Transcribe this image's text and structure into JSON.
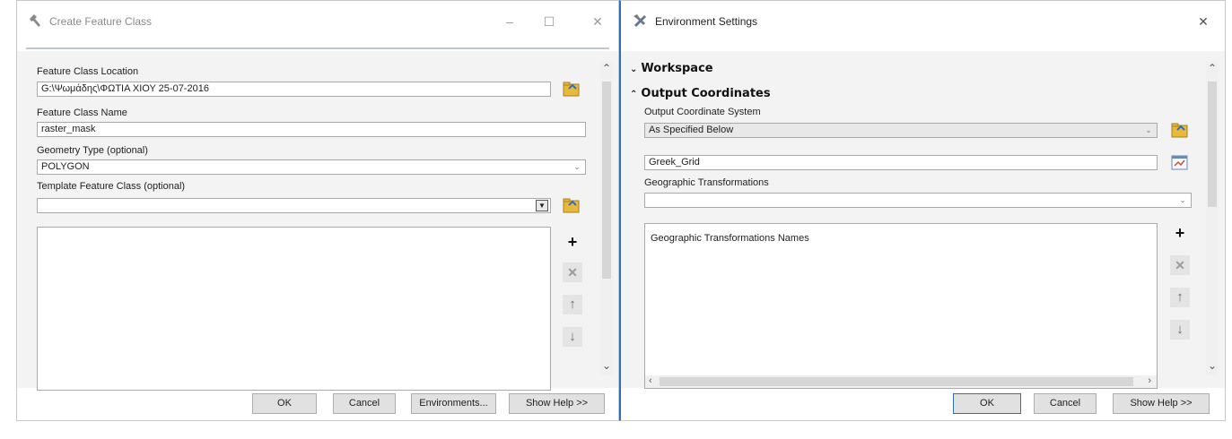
{
  "left_window": {
    "title": "Create Feature Class",
    "minimize": "–",
    "maximize": "☐",
    "close": "✕",
    "fields": {
      "location_label": "Feature Class Location",
      "location_value": "G:\\Ψωμάδης\\ΦΩΤΙΑ ΧΙΟΥ 25-07-2016",
      "name_label": "Feature Class Name",
      "name_value": "raster_mask",
      "geometry_label": "Geometry Type (optional)",
      "geometry_value": "POLYGON",
      "template_label": "Template Feature Class (optional)",
      "template_value": ""
    },
    "buttons": {
      "ok": "OK",
      "cancel": "Cancel",
      "environments": "Environments...",
      "show_help": "Show Help >>"
    }
  },
  "right_window": {
    "title": "Environment Settings",
    "close": "✕",
    "sections": {
      "workspace": "Workspace",
      "output_coordinates": "Output Coordinates"
    },
    "fields": {
      "ocs_label": "Output Coordinate System",
      "ocs_value": "As Specified Below",
      "grid_value": "Greek_Grid",
      "geo_trans_label": "Geographic Transformations",
      "geo_trans_value": "",
      "geo_trans_names_header": "Geographic Transformations Names"
    },
    "buttons": {
      "ok": "OK",
      "cancel": "Cancel",
      "show_help": "Show Help >>"
    }
  },
  "colors": {
    "accent": "#2f6fb7",
    "folder": "#e8b93a",
    "panel": "#f3f3f3"
  }
}
